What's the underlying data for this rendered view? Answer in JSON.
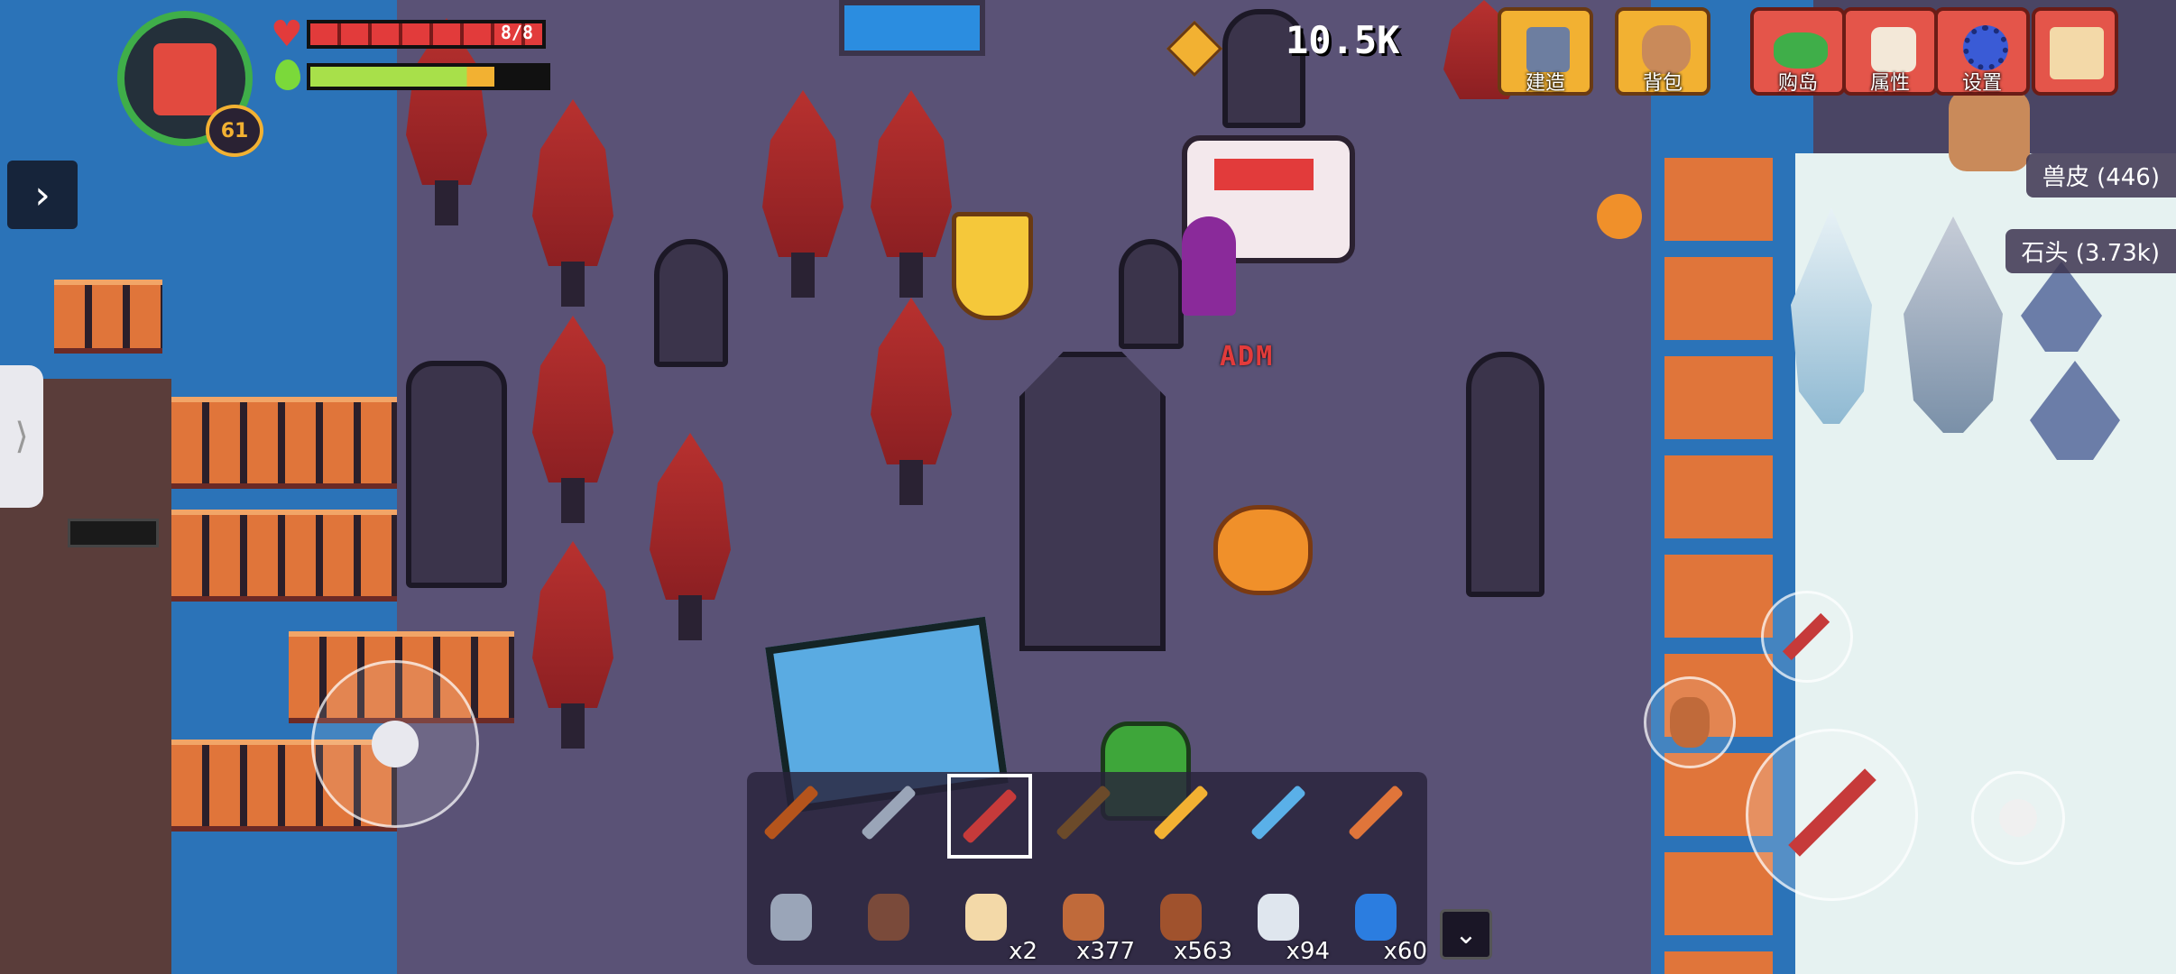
{
  "hud": {
    "level": "61",
    "health_text": "8/8",
    "health_fraction": 1.0,
    "energy_fraction": 0.78,
    "coins": "10.5K"
  },
  "top_buttons": [
    {
      "label": "建造",
      "icon": "hammer-build-icon"
    },
    {
      "label": "背包",
      "icon": "backpack-icon"
    },
    {
      "label": "购岛",
      "icon": "island-icon"
    },
    {
      "label": "属性",
      "icon": "skull-stats-icon"
    },
    {
      "label": "设置",
      "icon": "gear-icon"
    },
    {
      "label": "",
      "icon": "scroll-map-icon"
    }
  ],
  "resources": [
    {
      "label": "兽皮 (446)",
      "icon": "hide-icon"
    },
    {
      "label": "石头 (3.73k)",
      "icon": "stone-icon"
    }
  ],
  "world": {
    "npc_tag": "ADM"
  },
  "hotbar": {
    "weapons": [
      "pickaxe-icon",
      "shovel-icon",
      "sword-icon",
      "crossbow-icon",
      "golden-spear-icon",
      "ice-staff-icon",
      "fire-staff-icon"
    ],
    "selected_index": 2,
    "items": [
      {
        "icon": "hammer-icon",
        "count": ""
      },
      {
        "icon": "bow-icon",
        "count": ""
      },
      {
        "icon": "scroll-icon",
        "count": "x2"
      },
      {
        "icon": "meat-icon",
        "count": "x377"
      },
      {
        "icon": "drumstick-icon",
        "count": "x563"
      },
      {
        "icon": "bottle-icon",
        "count": "x94"
      },
      {
        "icon": "bomb-icon",
        "count": "x60"
      }
    ]
  },
  "colors": {
    "health": "#e23b3b",
    "energy": "#a8e04a",
    "gold": "#f2b132",
    "water": "#2b73b8"
  }
}
